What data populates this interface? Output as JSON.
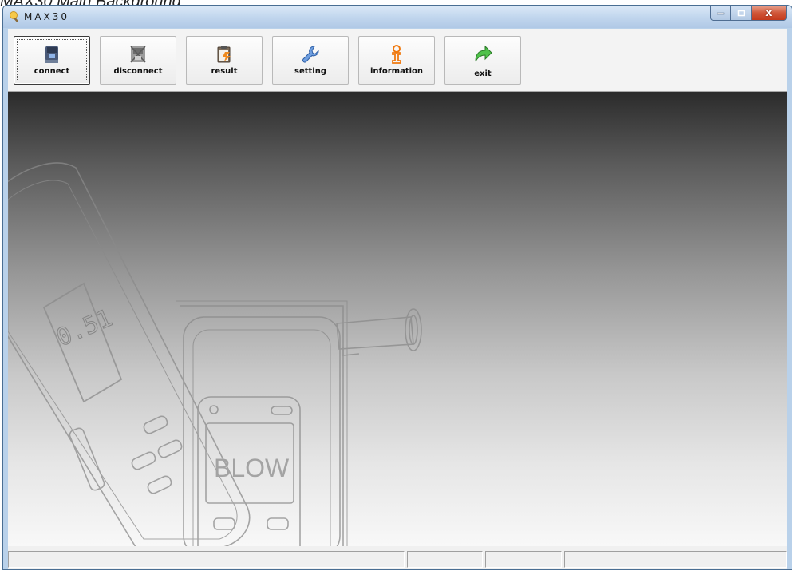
{
  "caption": "MAX30 Main Background",
  "window": {
    "title": "MAX30",
    "minimize_label": "",
    "close_label": "x"
  },
  "toolbar": {
    "buttons": [
      {
        "label": "connect",
        "icon": "usb-plug-icon",
        "selected": true
      },
      {
        "label": "disconnect",
        "icon": "unplug-icon",
        "selected": false
      },
      {
        "label": "result",
        "icon": "clipboard-result-icon",
        "selected": false
      },
      {
        "label": "setting",
        "icon": "wrench-icon",
        "selected": false
      },
      {
        "label": "information",
        "icon": "info-person-icon",
        "selected": false
      },
      {
        "label": "exit",
        "icon": "exit-arrow-icon",
        "selected": false
      }
    ]
  },
  "background": {
    "device_display_value": "0.51",
    "device_screen_text": "BLOW"
  },
  "statusbar": {
    "panels": [
      "",
      "",
      "",
      ""
    ]
  },
  "colors": {
    "titlebar": "#c2d7ee",
    "close_button": "#c43a1c",
    "canvas_top": "#2b2b2b",
    "canvas_bottom": "#f8f8f8"
  }
}
